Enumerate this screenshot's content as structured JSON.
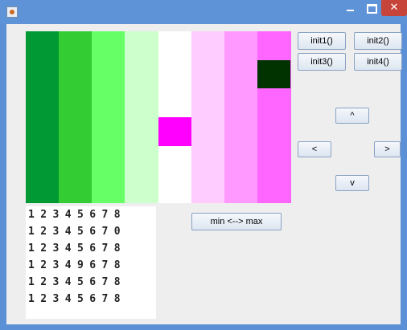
{
  "window": {
    "title": "",
    "icons": {
      "app": "java-app-icon",
      "minimize": "minimize-icon",
      "maximize": "maximize-icon",
      "close": "close-icon"
    }
  },
  "grid": {
    "columns": [
      {
        "color": "#009933"
      },
      {
        "color": "#33cc33"
      },
      {
        "color": "#66ff66"
      },
      {
        "color": "#ccffcc"
      },
      {
        "color": "#ffffff"
      },
      {
        "color": "#ffccff"
      },
      {
        "color": "#ff99ff"
      },
      {
        "color": "#ff66ff"
      }
    ],
    "highlights": [
      {
        "column": 7,
        "row": 1,
        "color": "#003300"
      },
      {
        "column": 4,
        "row": 3,
        "color": "#ff00ff"
      }
    ],
    "rows": 6
  },
  "buttons": {
    "init1": "init1()",
    "init2": "init2()",
    "init3": "init3()",
    "init4": "init4()",
    "up": "^",
    "left": "<",
    "right": ">",
    "down": "v",
    "minmax": "min <--> max"
  },
  "number_rows": [
    "1 2 3 4 5 6 7 8",
    "1 2 3 4 5 6 7 0",
    "1 2 3 4 5 6 7 8",
    "1 2 3 4 9 6 7 8",
    "1 2 3 4 5 6 7 8",
    "1 2 3 4 5 6 7 8"
  ]
}
